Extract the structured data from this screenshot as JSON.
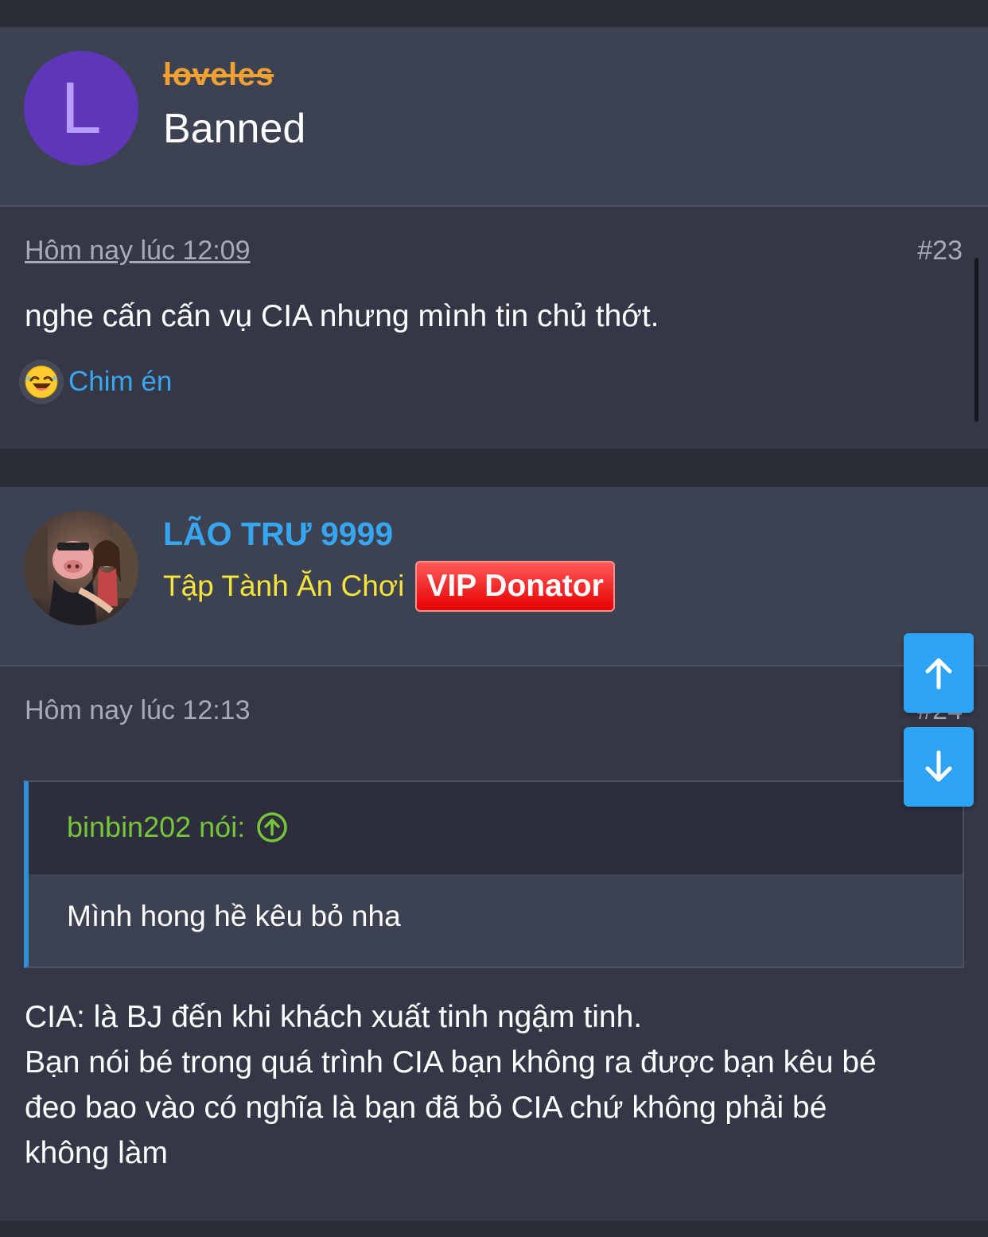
{
  "posts": [
    {
      "avatar_letter": "L",
      "username": "loveles",
      "user_title": "Banned",
      "timestamp": "Hôm nay lúc 12:09",
      "post_number": "#23",
      "message": "nghe cấn cấn vụ CIA nhưng mình tin chủ thớt.",
      "reaction_label": "Chim én"
    },
    {
      "username": "LÃO TRƯ 9999",
      "rank": "Tập Tành Ăn Chơi",
      "badge": "VIP Donator",
      "timestamp": "Hôm nay lúc 12:13",
      "post_number": "#24",
      "quote": {
        "author": "binbin202 nói:",
        "text": "Mình hong hề kêu bỏ nha"
      },
      "body_lines": [
        "CIA: là BJ đến khi khách xuất tinh ngậm tinh.",
        "Bạn nói bé trong quá trình CIA bạn không ra được bạn kêu bé",
        "đeo bao vào có nghĩa là bạn đã bỏ CIA chứ không phải bé",
        "không làm"
      ]
    }
  ],
  "icons": {
    "reaction": "laughing-face-icon",
    "quote_jump": "arrow-up-circle-icon",
    "scroll_up": "arrow-up-icon",
    "scroll_down": "arrow-down-icon"
  },
  "colors": {
    "background": "#2b2e39",
    "banned_username": "#f0a133",
    "member_username": "#37a6f0",
    "rank": "#f6e43a",
    "vip_badge": "#e60000",
    "quote_author": "#77c53a",
    "link": "#39a6ee"
  }
}
